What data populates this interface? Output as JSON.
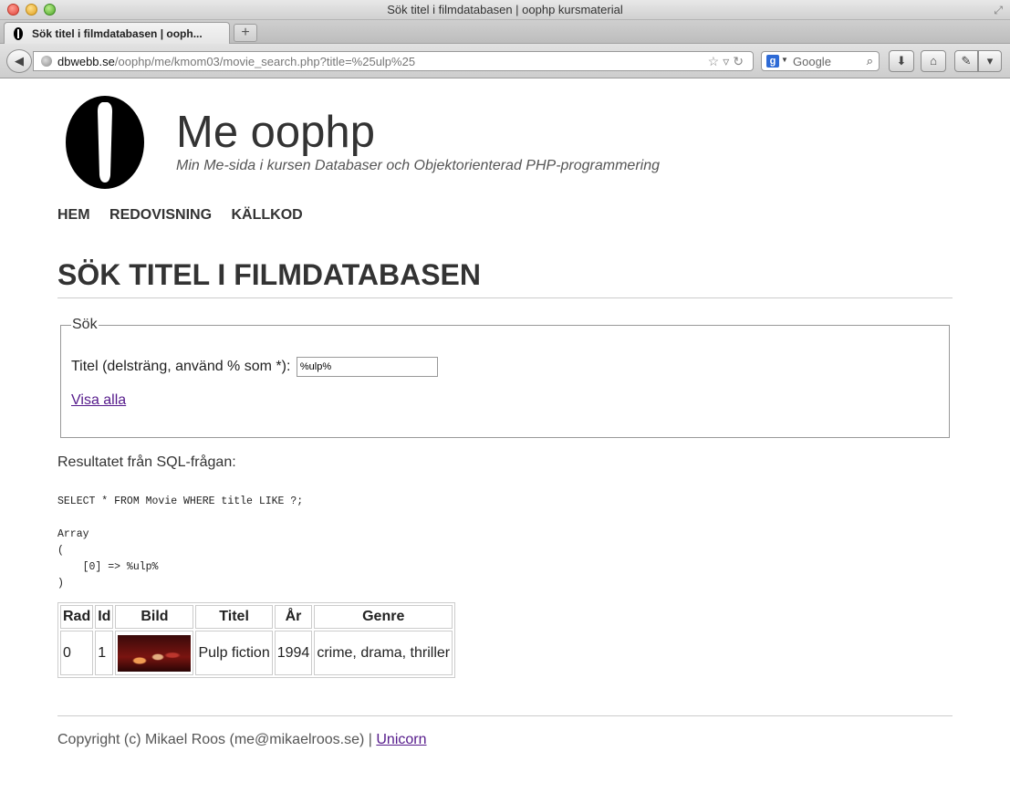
{
  "browser": {
    "window_title": "Sök titel i filmdatabasen | oophp kursmaterial",
    "tab_title": "Sök titel i filmdatabasen | ooph...",
    "new_tab_label": "+",
    "url_domain": "dbwebb.se",
    "url_path": "/oophp/me/kmom03/movie_search.php?title=%25ulp%25",
    "search_engine": "Google"
  },
  "header": {
    "site_title": "Me oophp",
    "site_slogan": "Min Me-sida i kursen Databaser och Objektorienterad PHP-programmering"
  },
  "menu": {
    "items": [
      {
        "label": "Hem"
      },
      {
        "label": "Redovisning"
      },
      {
        "label": "Källkod"
      }
    ]
  },
  "main": {
    "heading": "Sök titel i filmdatabasen",
    "form": {
      "legend": "Sök",
      "title_label": "Titel (delsträng, använd % som *):",
      "title_value": "%ulp%",
      "show_all_link": "Visa alla"
    },
    "result_label": "Resultatet från SQL-frågan:",
    "sql_query": "SELECT * FROM Movie WHERE title LIKE ?;",
    "params_dump": "Array\n(\n    [0] => %ulp%\n)",
    "table": {
      "headers": [
        "Rad",
        "Id",
        "Bild",
        "Titel",
        "År",
        "Genre"
      ],
      "rows": [
        {
          "rad": "0",
          "id": "1",
          "titel": "Pulp fiction",
          "ar": "1994",
          "genre": "crime, drama, thriller"
        }
      ]
    }
  },
  "footer": {
    "copyright": "Copyright (c) Mikael Roos (me@mikaelroos.se) | ",
    "link_label": "Unicorn"
  }
}
